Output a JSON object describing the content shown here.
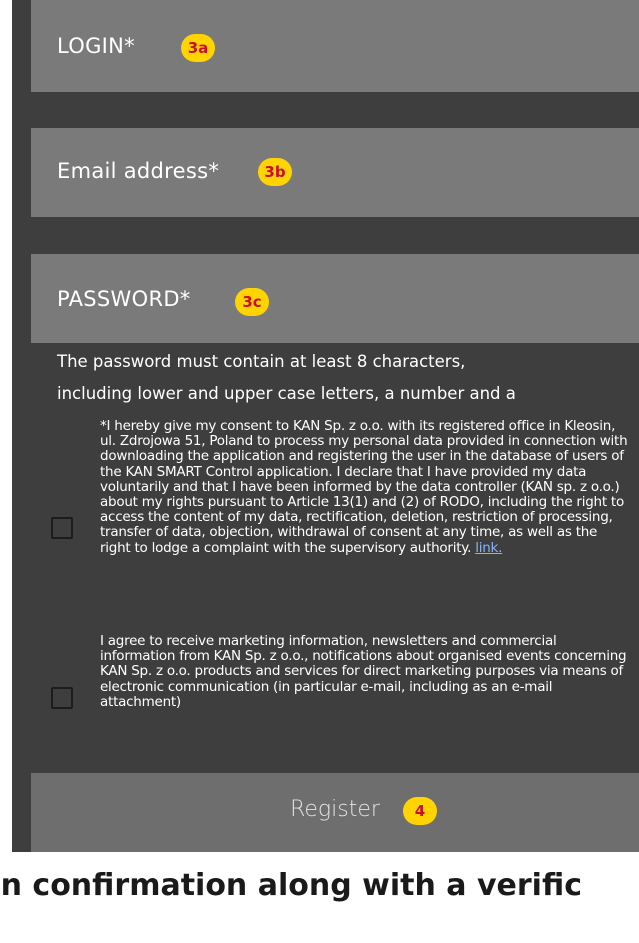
{
  "form": {
    "login_label": "LOGIN*",
    "login_badge": "3a",
    "email_label": "Email address*",
    "email_badge": "3b",
    "password_label": "PASSWORD*",
    "password_badge": "3c",
    "password_hint_line1": "The password must contain at least 8 characters,",
    "password_hint_line2": "including lower and upper case letters, a number and a",
    "consent_gdpr_text": "*I hereby give my consent to KAN Sp. z o.o. with its registered office in Kleosin, ul. Zdrojowa 51, Poland to process my personal data provided in connection with downloading the application and registering the user in the database of users of the KAN SMART Control application. I declare that I have provided my data voluntarily and that I have been informed by the data controller (KAN sp. z o.o.) about my rights pursuant to Article 13(1) and (2) of RODO, including the right to access the content of my data, rectification, deletion, restriction of processing, transfer of data, objection, withdrawal of consent at any time, as well as the right to lodge a complaint with the supervisory authority.",
    "consent_gdpr_link": "link.",
    "consent_marketing_text": "I agree to receive marketing information, newsletters and commercial information from KAN Sp. z o.o., notifications about organised events concerning KAN Sp. z o.o. products and services for direct marketing purposes via means of electronic communication (in particular e-mail, including as an e-mail attachment)",
    "register_label": "Register",
    "register_badge": "4"
  },
  "caption": "on confirmation along with a verific",
  "colors": {
    "background": "#3e3e3e",
    "field": "#7a7a7a",
    "button": "#6e6e6e",
    "badge": "#ffd400",
    "badge_text": "#c8102e",
    "link": "#8ab4f8"
  }
}
